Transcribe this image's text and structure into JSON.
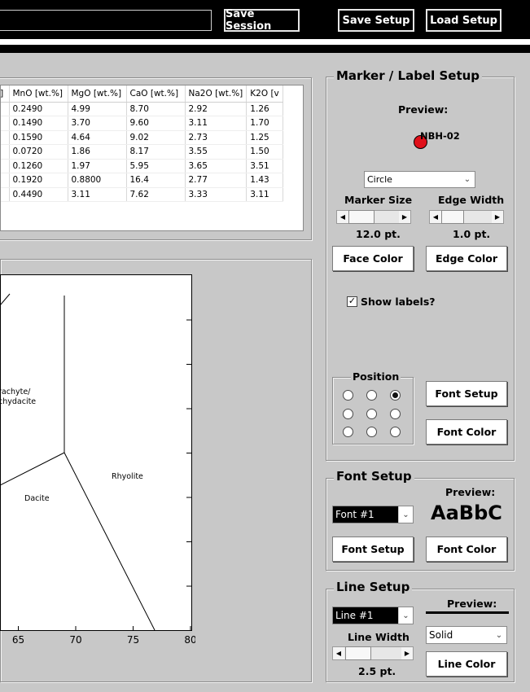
{
  "toolbar": {
    "save_session": "Save Session",
    "save_setup": "Save Setup",
    "load_setup": "Load Setup"
  },
  "table": {
    "headers": [
      "[wt.%]",
      "MnO [wt.%]",
      "MgO [wt.%]",
      "CaO [wt.%]",
      "Na2O [wt.%]",
      "K2O [v"
    ],
    "rows": [
      [
        "",
        "0.2490",
        "4.99",
        "8.70",
        "2.92",
        "1.26"
      ],
      [
        "",
        "0.1490",
        "3.70",
        "9.60",
        "3.11",
        "1.70"
      ],
      [
        "",
        "0.1590",
        "4.64",
        "9.02",
        "2.73",
        "1.25"
      ],
      [
        "",
        "0.0720",
        "1.86",
        "8.17",
        "3.55",
        "1.50"
      ],
      [
        "",
        "0.1260",
        "1.97",
        "5.95",
        "3.65",
        "3.51"
      ],
      [
        "",
        "0.1920",
        "0.8800",
        "16.4",
        "2.77",
        "1.43"
      ],
      [
        "",
        "0.4490",
        "3.11",
        "7.62",
        "3.33",
        "3.11"
      ]
    ],
    "scroll_right": ">"
  },
  "chart_data": {
    "type": "scatter",
    "x_ticks": [
      "65",
      "70",
      "75",
      "80"
    ],
    "xlim": [
      60,
      80
    ],
    "field_labels": [
      "rachyte/",
      "chydacite",
      "Rhyolite",
      "Dacite"
    ]
  },
  "marker_setup": {
    "title": "Marker / Label Setup",
    "preview_label": "Preview:",
    "preview_text": "NBH-02",
    "marker_color": "#e0101a",
    "shape_value": "Circle",
    "marker_size_label": "Marker Size",
    "edge_width_label": "Edge Width",
    "marker_size_value": "12.0 pt.",
    "edge_width_value": "1.0 pt.",
    "face_color": "Face Color",
    "edge_color": "Edge Color",
    "show_labels": "Show labels?",
    "position_title": "Position",
    "font_setup": "Font Setup",
    "font_color": "Font Color"
  },
  "font_setup": {
    "title": "Font Setup",
    "preview_label": "Preview:",
    "font_value": "Font #1",
    "preview_sample": "AaBbC",
    "font_setup_btn": "Font Setup",
    "font_color_btn": "Font Color"
  },
  "line_setup": {
    "title": "Line Setup",
    "preview_label": "Preview:",
    "line_value": "Line #1",
    "line_width_label": "Line Width",
    "style_value": "Solid",
    "line_width_value": "2.5 pt.",
    "line_color": "Line Color"
  }
}
